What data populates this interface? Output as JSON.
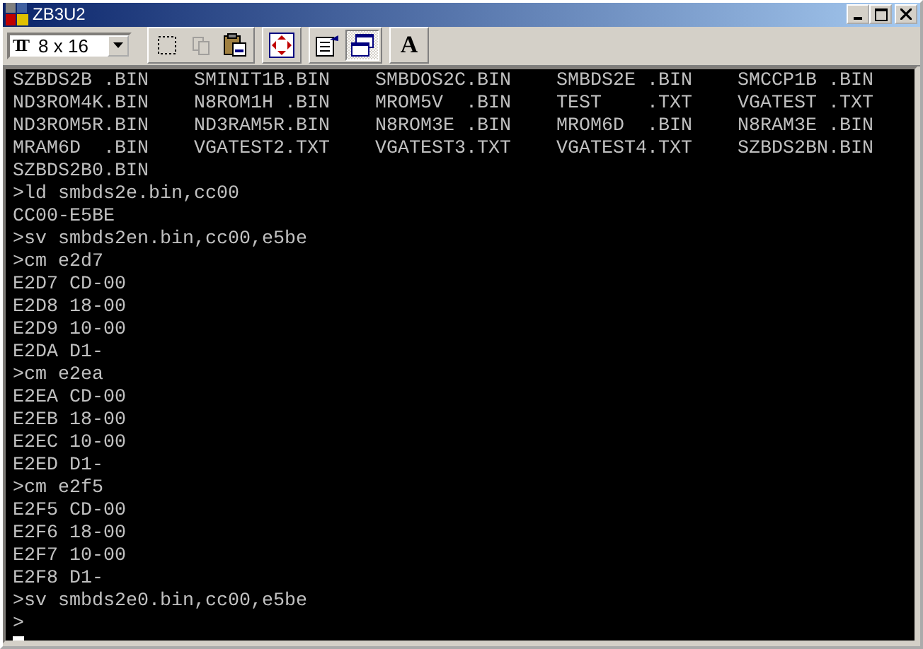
{
  "window": {
    "title": "ZB3U2"
  },
  "toolbar": {
    "font_icon": "TT",
    "font_size": "8 x 16",
    "buttons": [
      {
        "kind": "mark",
        "disabled": false,
        "pressed": false
      },
      {
        "kind": "copy",
        "disabled": true,
        "pressed": false
      },
      {
        "kind": "paste",
        "disabled": false,
        "pressed": false
      },
      {
        "kind": "fullscreen",
        "disabled": false,
        "pressed": false
      },
      {
        "kind": "properties",
        "disabled": false,
        "pressed": false
      },
      {
        "kind": "background",
        "disabled": false,
        "pressed": true
      },
      {
        "kind": "font",
        "label": "A",
        "disabled": false,
        "pressed": false
      }
    ]
  },
  "console": {
    "file_listing": [
      "SZBDS2B .BIN",
      "SMINIT1B.BIN",
      "SMBDOS2C.BIN",
      "SMBDS2E .BIN",
      "SMCCP1B .BIN",
      "ND3ROM4K.BIN",
      "N8ROM1H .BIN",
      "MROM5V  .BIN",
      "TEST    .TXT",
      "VGATEST .TXT",
      "ND3ROM5R.BIN",
      "ND3RAM5R.BIN",
      "N8ROM3E .BIN",
      "MROM6D  .BIN",
      "N8RAM3E .BIN",
      "MRAM6D  .BIN",
      "VGATEST2.TXT",
      "VGATEST3.TXT",
      "VGATEST4.TXT",
      "SZBDS2BN.BIN",
      "SZBDS2B0.BIN"
    ],
    "lines": [
      ">ld smbds2e.bin,cc00",
      "CC00-E5BE",
      ">sv smbds2en.bin,cc00,e5be",
      ">cm e2d7",
      "E2D7 CD-00",
      "E2D8 18-00",
      "E2D9 10-00",
      "E2DA D1-",
      ">cm e2ea",
      "E2EA CD-00",
      "E2EB 18-00",
      "E2EC 10-00",
      "E2ED D1-",
      ">cm e2f5",
      "E2F5 CD-00",
      "E2F6 18-00",
      "E2F7 10-00",
      "E2F8 D1-",
      ">sv smbds2e0.bin,cc00,e5be"
    ],
    "prompt": ">"
  }
}
